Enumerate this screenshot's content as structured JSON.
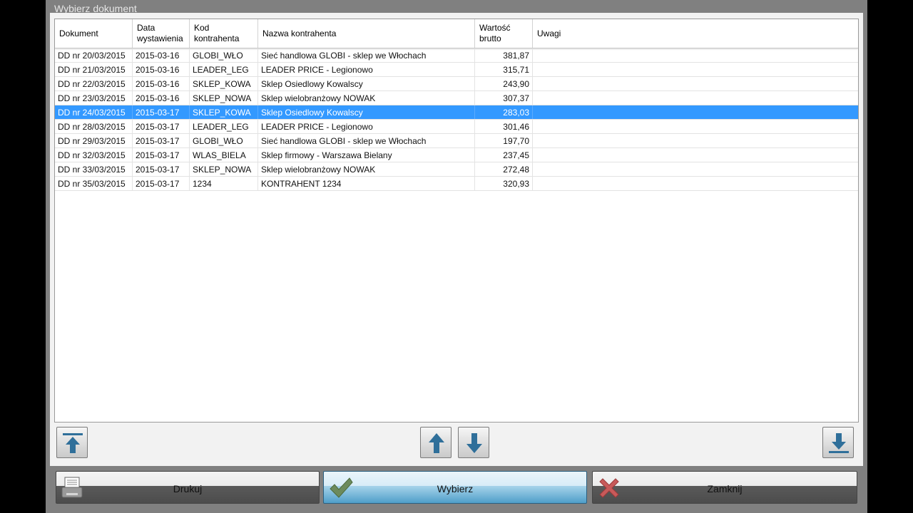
{
  "window": {
    "title": "Wybierz dokument"
  },
  "columns": [
    {
      "line1": "Dokument",
      "line2": ""
    },
    {
      "line1": "Data",
      "line2": "wystawienia"
    },
    {
      "line1": "Kod",
      "line2": "kontrahenta"
    },
    {
      "line1": "Nazwa kontrahenta",
      "line2": ""
    },
    {
      "line1": "Wartość",
      "line2": "brutto"
    },
    {
      "line1": "Uwagi",
      "line2": ""
    }
  ],
  "rows": [
    {
      "dokument": "DD nr 20/03/2015",
      "data": "2015-03-16",
      "kod": "GLOBI_WŁO",
      "nazwa": "Sieć handlowa GLOBI - sklep we Włochach",
      "wartosc": "381,87",
      "uwagi": ""
    },
    {
      "dokument": "DD nr 21/03/2015",
      "data": "2015-03-16",
      "kod": "LEADER_LEG",
      "nazwa": "LEADER PRICE - Legionowo",
      "wartosc": "315,71",
      "uwagi": ""
    },
    {
      "dokument": "DD nr 22/03/2015",
      "data": "2015-03-16",
      "kod": "SKLEP_KOWA",
      "nazwa": "Sklep Osiedlowy Kowalscy",
      "wartosc": "243,90",
      "uwagi": ""
    },
    {
      "dokument": "DD nr 23/03/2015",
      "data": "2015-03-16",
      "kod": "SKLEP_NOWA",
      "nazwa": "Sklep wielobranżowy NOWAK",
      "wartosc": "307,37",
      "uwagi": ""
    },
    {
      "dokument": "DD nr 24/03/2015",
      "data": "2015-03-17",
      "kod": "SKLEP_KOWA",
      "nazwa": "Sklep Osiedlowy Kowalscy",
      "wartosc": "283,03",
      "uwagi": ""
    },
    {
      "dokument": "DD nr 28/03/2015",
      "data": "2015-03-17",
      "kod": "LEADER_LEG",
      "nazwa": "LEADER PRICE - Legionowo",
      "wartosc": "301,46",
      "uwagi": ""
    },
    {
      "dokument": "DD nr 29/03/2015",
      "data": "2015-03-17",
      "kod": "GLOBI_WŁO",
      "nazwa": "Sieć handlowa GLOBI - sklep we Włochach",
      "wartosc": "197,70",
      "uwagi": ""
    },
    {
      "dokument": "DD nr 32/03/2015",
      "data": "2015-03-17",
      "kod": "WLAS_BIELA",
      "nazwa": "Sklep firmowy - Warszawa Bielany",
      "wartosc": "237,45",
      "uwagi": ""
    },
    {
      "dokument": "DD nr 33/03/2015",
      "data": "2015-03-17",
      "kod": "SKLEP_NOWA",
      "nazwa": "Sklep wielobranżowy NOWAK",
      "wartosc": "272,48",
      "uwagi": ""
    },
    {
      "dokument": "DD nr 35/03/2015",
      "data": "2015-03-17",
      "kod": "1234",
      "nazwa": "KONTRAHENT 1234",
      "wartosc": "320,93",
      "uwagi": ""
    }
  ],
  "selected_row_index": 4,
  "nav": {
    "first_icon": "arrow-to-top-icon",
    "up_icon": "arrow-up-icon",
    "down_icon": "arrow-down-icon",
    "last_icon": "arrow-to-bottom-icon"
  },
  "actions": {
    "print_label": "Drukuj",
    "select_label": "Wybierz",
    "close_label": "Zamknij",
    "print_icon": "printer-icon",
    "select_icon": "checkmark-icon",
    "close_icon": "cross-icon"
  },
  "colors": {
    "selection": "#3399ff",
    "window_frame": "#808080",
    "nav_arrow": "#2f6f9a",
    "check": "#6c8a5c",
    "cross": "#c85a5a"
  }
}
